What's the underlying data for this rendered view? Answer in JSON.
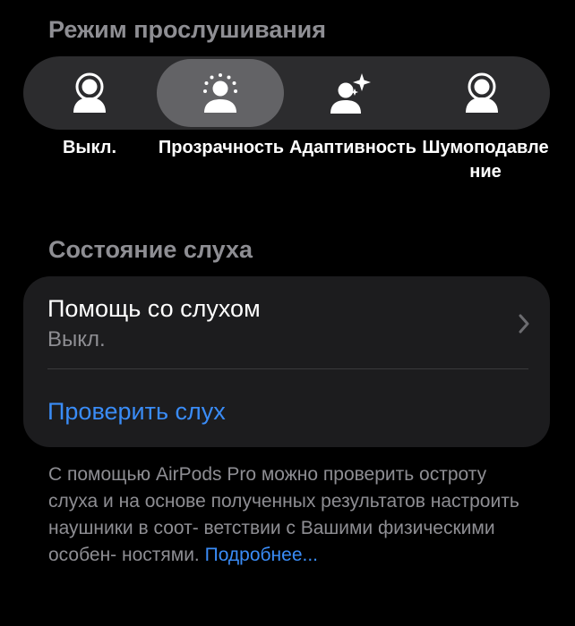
{
  "listening_mode": {
    "header": "Режим прослушивания",
    "modes": [
      {
        "label": "Выкл.",
        "icon": "person-off-icon",
        "selected": false
      },
      {
        "label": "Прозрачность",
        "icon": "person-transparency-icon",
        "selected": true
      },
      {
        "label": "Адаптивность",
        "icon": "person-adaptive-icon",
        "selected": false
      },
      {
        "label": "Шумоподавление",
        "icon": "person-noise-cancel-icon",
        "selected": false
      }
    ]
  },
  "hearing_health": {
    "header": "Состояние слуха",
    "hearing_assistance": {
      "title": "Помощь со слухом",
      "value": "Выкл."
    },
    "check_hearing_label": "Проверить слух",
    "footer_text": "С помощью AirPods Pro можно проверить остроту слуха и на основе полученных результатов настроить наушники в соот- ветствии с Вашими физическими особен- ностями.",
    "footer_link": "Подробнее..."
  },
  "colors": {
    "background": "#000000",
    "card": "#1c1c1e",
    "segment_track": "#2c2c2e",
    "segment_selected": "#636366",
    "secondary_text": "#8e8e93",
    "link": "#3a8cf7"
  }
}
